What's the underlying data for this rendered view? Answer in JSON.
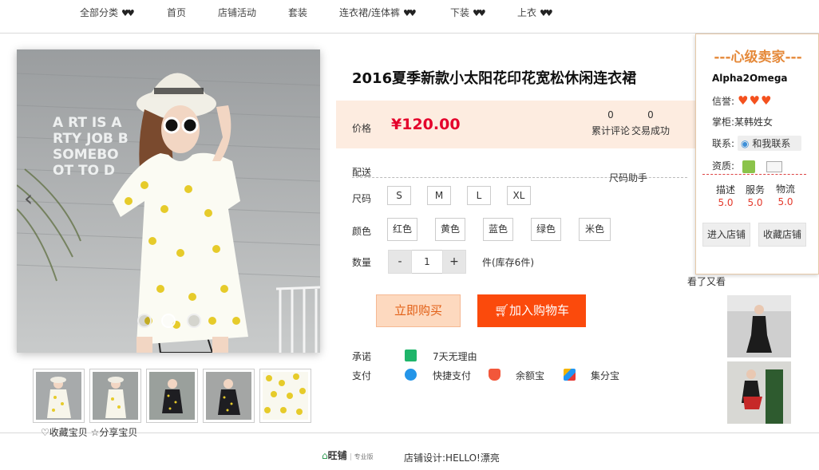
{
  "nav": {
    "items": [
      {
        "label": "全部分类",
        "heart": true
      },
      {
        "label": "首页",
        "heart": false
      },
      {
        "label": "店铺活动",
        "heart": false
      },
      {
        "label": "套装",
        "heart": false
      },
      {
        "label": "连衣裙/连体裤",
        "heart": true
      },
      {
        "label": "下装",
        "heart": true
      },
      {
        "label": "上衣",
        "heart": true
      }
    ],
    "heart_glyph": "♥♥"
  },
  "gallery": {
    "wall_text": [
      "A  RT IS  A",
      "RTY JOB B",
      "SOMEBO",
      "OT TO D"
    ],
    "thumbnails": [
      {
        "name": "yellow-floral-dress-front"
      },
      {
        "name": "yellow-floral-dress-side"
      },
      {
        "name": "black-floral-dress-front"
      },
      {
        "name": "black-floral-dress-side"
      },
      {
        "name": "fabric-close-up"
      }
    ],
    "favorite_label": "收藏宝贝",
    "share_label": "分享宝贝"
  },
  "product": {
    "title": "2016夏季新款小太阳花印花宽松休闲连衣裙",
    "price_label": "价格",
    "price": "¥120.00",
    "reviews_count": "0",
    "reviews_label": "累计评论",
    "sold_count": "0",
    "sold_label": "交易成功",
    "shipping_label": "配送",
    "size_helper": "尺码助手",
    "size_label": "尺码",
    "sizes": [
      "S",
      "M",
      "L",
      "XL"
    ],
    "color_label": "颜色",
    "colors": [
      "红色",
      "黄色",
      "蓝色",
      "绿色",
      "米色"
    ],
    "qty_label": "数量",
    "qty_minus": "-",
    "qty_value": "1",
    "qty_plus": "+",
    "stock_text": "件(库存6件)",
    "buy_now": "立即购买",
    "add_to_cart": "加入购物车",
    "promise_label": "承诺",
    "promise_text": "7天无理由",
    "payment_label": "支付",
    "payments": [
      "快捷支付",
      "余额宝",
      "集分宝"
    ]
  },
  "seller": {
    "level": "---心级卖家---",
    "shop_name": "Alpha2Omega",
    "credit_label": "信誉:",
    "credit_hearts": "♥♥♥",
    "owner_label": "掌柜:",
    "owner": "某韩姓女",
    "contact_label": "联系:",
    "contact_button": "和我联系",
    "qualification_label": "资质:",
    "scores": [
      {
        "label": "描述",
        "value": "5.0"
      },
      {
        "label": "服务",
        "value": "5.0"
      },
      {
        "label": "物流",
        "value": "5.0"
      }
    ],
    "enter_shop": "进入店铺",
    "favorite_shop": "收藏店铺",
    "colors": {
      "accent": "#e58a3b",
      "score": "#e4392b"
    }
  },
  "seen": {
    "label": "看了又看"
  },
  "footer": {
    "logo_text": "旺铺",
    "logo_sub": "专业版",
    "design_text": "店铺设计:HELLO!漂亮"
  },
  "colors": {
    "price": "#e4002b",
    "cart_button": "#fb4a0c",
    "buy_button_bg": "#fdd9bf",
    "price_bg": "#fdece0"
  }
}
